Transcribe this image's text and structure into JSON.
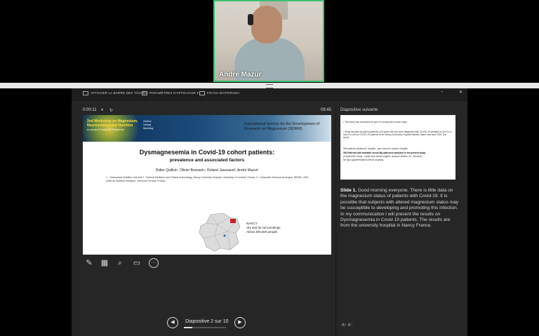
{
  "webcam": {
    "name": "André Mazur"
  },
  "toolbar": {
    "show_taskbar": "AFFICHER LA BARRE DES TÂCHES",
    "display_settings": "PARAMÈTRES D'AFFICHAGE ▾",
    "end_show": "FIN DU DIAPORAMA",
    "minimize": "–",
    "close": "✕"
  },
  "timer": {
    "elapsed": "0:00:11",
    "pause": "⏸",
    "reset": "↻",
    "clock": "09:45"
  },
  "slide": {
    "workshop_title": "2nd Workshop on Magnesium, Neuroscience and Nutrition",
    "workshop_sub": "in current Covid-19 Pandemic",
    "online": "Online Virtual Meeting",
    "society": "International Society for the Development of Research on Magnesium (SDRM)",
    "title": "Dysmagnesemia in Covid-19 cohort patients:",
    "subtitle": "prevalence and associated factors",
    "authors": "Didier Quilliot¹, Olivier Bonsack¹, Roland Jaussaud², André Mazur³",
    "affiliations": "1 - Transversal Nutrition Unit and 2 - Internal Medicine and Clinical Immunology, Nancy University Hospital, University of Lorraine, France; 3 - Université Clermont Auvergne, INRAE, UNH, Unité de Nutrition Humaine, Clermont-Ferrand, France.",
    "nancy": "NANCY",
    "nancy_line2": "city and its surroundings",
    "nancy_line3": "About 300,000 people"
  },
  "tools": {
    "pen": "pen-icon",
    "grid": "grid-icon",
    "zoom": "magnifier-icon",
    "screen": "screen-icon",
    "more": "···"
  },
  "nav": {
    "prev": "◀",
    "next": "▶",
    "counter": "Diapositive 2 sur 10",
    "progress_fraction": 0.2
  },
  "next_slide": {
    "label": "Diapositive suivante",
    "line1": "• This study was conducted as part of a prospective cohort study",
    "line2": "• Study included all adult inpatients (≥18 years old) who were diagnosed with COVID-19 admitted in an ICU or non-ICU unit for COVID-19 patients at the Nancy University Hospital between March and April 2020. [1st wave]",
    "line3": "549 patients admitted to hospital - part moved to another hospital",
    "line4": "300 Patients with available serum Mg data were analyzed in the present study",
    "line5": "(Colorimetric assay - xylidyl blue based reagent, analyser Atellica CH, Siemens)",
    "line6": "No Mg supplementation before sampling"
  },
  "notes": {
    "slide_no": "Slide 1.",
    "text": " Good morning everyone. There is little data on the magnesium status of patients with Covid-19.  It is possible that subjects with altered magnesium status may be susceptible to developing and promoting this infection.  In my communication I will present the results on Dysmagnesemia in Covid 19 patients. The results are from the university hospital in Nancy France."
  },
  "font_controls": "A⁺  A⁻",
  "colors": {
    "webcam_border": "#3fbf6f",
    "banner": "#0c2e57",
    "panel": "#262626"
  }
}
